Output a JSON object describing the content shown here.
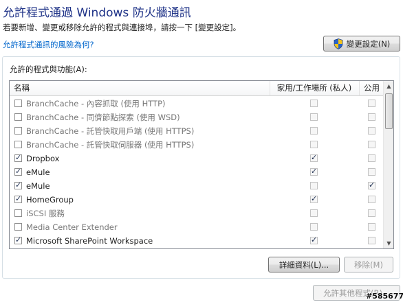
{
  "header": {
    "title": "允許程式通過 Windows 防火牆通訊",
    "description": "若要新增、變更或移除允許的程式與連接埠，請按一下 [變更設定]。",
    "risk_link": "允許程式通訊的風險為何?",
    "change_settings_button": "變更設定(N)",
    "change_settings_icon": "uac-shield-icon"
  },
  "allowed": {
    "group_label": "允許的程式與功能(A):",
    "columns": {
      "name": "名稱",
      "home_work": "家用/工作場所 (私人)",
      "public": "公用"
    },
    "rows": [
      {
        "enabled": false,
        "name": "BranchCache - 內容抓取 (使用 HTTP)",
        "home_work": false,
        "public": false
      },
      {
        "enabled": false,
        "name": "BranchCache - 同儕節點探索 (使用 WSD)",
        "home_work": false,
        "public": false
      },
      {
        "enabled": false,
        "name": "BranchCache - 託管快取用戶端 (使用 HTTPS)",
        "home_work": false,
        "public": false
      },
      {
        "enabled": false,
        "name": "BranchCache - 託管快取伺服器 (使用 HTTPS)",
        "home_work": false,
        "public": false
      },
      {
        "enabled": true,
        "name": "Dropbox",
        "home_work": true,
        "public": false
      },
      {
        "enabled": true,
        "name": "eMule",
        "home_work": true,
        "public": false
      },
      {
        "enabled": true,
        "name": "eMule",
        "home_work": false,
        "public": true
      },
      {
        "enabled": true,
        "name": "HomeGroup",
        "home_work": true,
        "public": false
      },
      {
        "enabled": false,
        "name": "iSCSI 服務",
        "home_work": false,
        "public": false
      },
      {
        "enabled": false,
        "name": "Media Center Extender",
        "home_work": false,
        "public": false
      },
      {
        "enabled": true,
        "name": "Microsoft SharePoint Workspace",
        "home_work": true,
        "public": false
      }
    ],
    "scroll_position": 0.0,
    "details_button": "詳細資料(L)...",
    "remove_button": "移除(M)"
  },
  "footer": {
    "allow_other_button": "允許其他程式(R)..."
  },
  "watermark": "#585677"
}
